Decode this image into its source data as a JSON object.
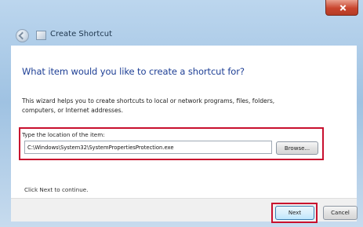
{
  "window": {
    "title": "Create Shortcut",
    "close_icon": "close-icon",
    "back_icon": "back-arrow-icon",
    "app_icon": "shortcut-icon"
  },
  "main": {
    "heading": "What item would you like to create a shortcut for?",
    "description": "This wizard helps you to create shortcuts to local or network programs, files, folders,\ncomputers, or Internet addresses.",
    "location_label": "Type the location of the item:",
    "location_value": "C:\\Windows\\System32\\SystemPropertiesProtection.exe",
    "browse_label": "Browse...",
    "continue_text": "Click Next to continue."
  },
  "footer": {
    "next_label": "Next",
    "cancel_label": "Cancel"
  },
  "colors": {
    "heading": "#1e3f95",
    "highlight": "#c8102e",
    "frame": "#9fc2e2"
  }
}
